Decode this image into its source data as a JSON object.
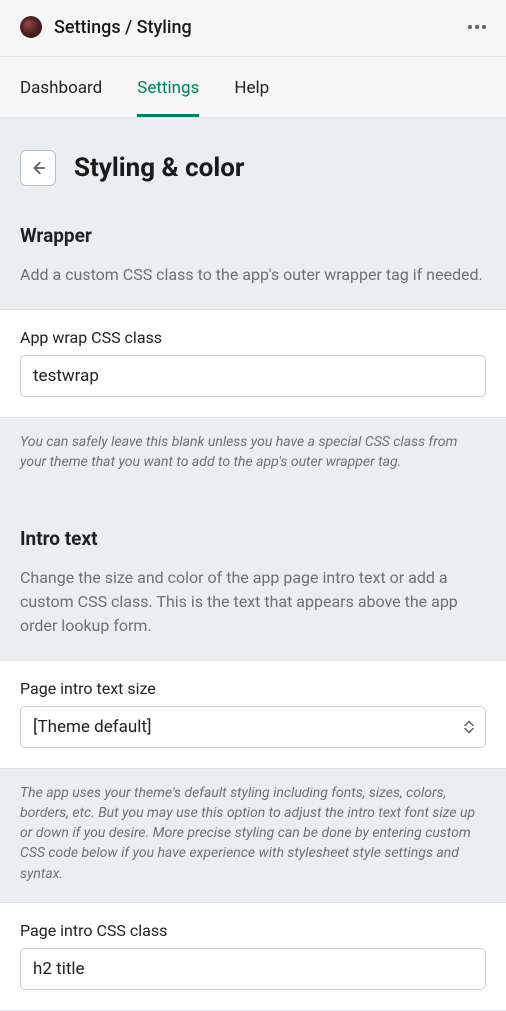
{
  "header": {
    "breadcrumb": "Settings / Styling"
  },
  "tabs": [
    {
      "label": "Dashboard",
      "active": false
    },
    {
      "label": "Settings",
      "active": true
    },
    {
      "label": "Help",
      "active": false
    }
  ],
  "page": {
    "title": "Styling & color"
  },
  "wrapper_section": {
    "title": "Wrapper",
    "desc": "Add a custom CSS class to the app's outer wrapper tag if needed.",
    "field_label": "App wrap CSS class",
    "field_value": "testwrap",
    "help": "You can safely leave this blank unless you have a special CSS class from your theme that you want to add to the app's outer wrapper tag."
  },
  "intro_section": {
    "title": "Intro text",
    "desc": "Change the size and color of the app page intro text or add a custom CSS class. This is the text that appears above the app order lookup form.",
    "size_label": "Page intro text size",
    "size_value": "[Theme default]",
    "size_help": "The app uses your theme's default styling including fonts, sizes, colors, borders, etc. But you may use this option to adjust the intro text font size up or down if you desire. More precise styling can be done by entering custom CSS code below if you have experience with stylesheet style settings and syntax.",
    "class_label": "Page intro CSS class",
    "class_value": "h2 title"
  }
}
